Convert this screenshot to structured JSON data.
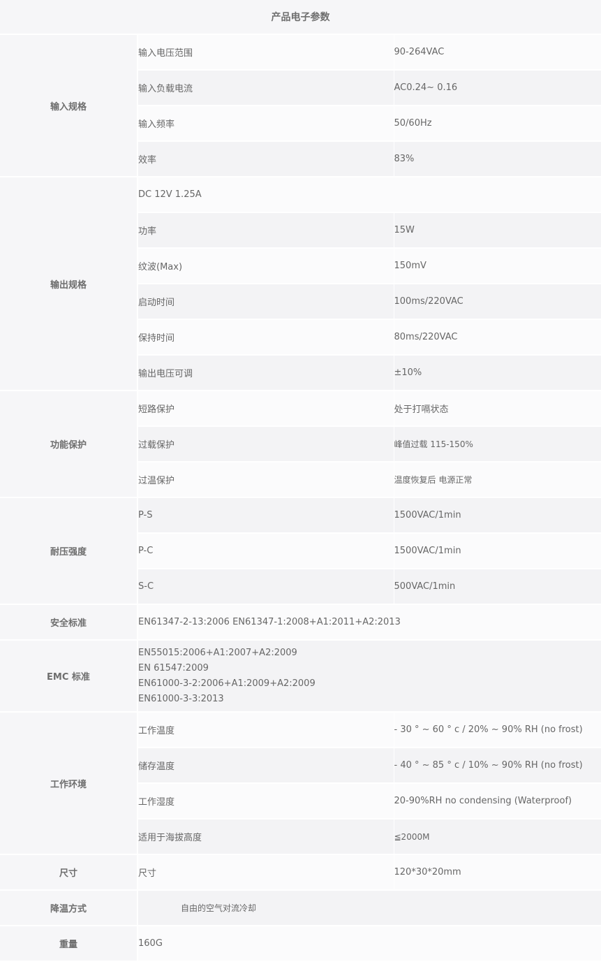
{
  "title": "产品电子参数",
  "input": {
    "label": "输入规格",
    "rows": [
      [
        "输入电压范围",
        "90-264VAC"
      ],
      [
        "输入负载电流",
        "AC0.24~ 0.16"
      ],
      [
        "输入频率",
        "50/60Hz"
      ],
      [
        "效率",
        "83%"
      ]
    ]
  },
  "output": {
    "label": "输出规格",
    "spec": "DC 12V 1.25A",
    "rows": [
      [
        "功率",
        "15W"
      ],
      [
        "纹波(Max)",
        "150mV"
      ],
      [
        "启动时间",
        "100ms/220VAC"
      ],
      [
        "保持时间",
        "80ms/220VAC"
      ],
      [
        "输出电压可调",
        "±10%"
      ]
    ]
  },
  "protection": {
    "label": "功能保护",
    "rows": [
      [
        "短路保护",
        "处于打嗝状态"
      ],
      [
        "过载保护",
        "峰值过载 115-150%"
      ],
      [
        "过温保护",
        "温度恢复后 电源正常"
      ]
    ]
  },
  "withstand": {
    "label": "耐压强度",
    "rows": [
      [
        "P-S",
        "1500VAC/1min"
      ],
      [
        "P-C",
        "1500VAC/1min"
      ],
      [
        "S-C",
        "500VAC/1min"
      ]
    ]
  },
  "safety": {
    "label": "安全标准",
    "value": "EN61347-2-13:2006  EN61347-1:2008+A1:2011+A2:2013"
  },
  "emc": {
    "label": "EMC 标准",
    "lines": [
      "EN55015:2006+A1:2007+A2:2009",
      "EN 61547:2009",
      "EN61000-3-2:2006+A1:2009+A2:2009",
      "EN61000-3-3:2013"
    ]
  },
  "environment": {
    "label": "工作环境",
    "rows": [
      [
        "工作温度",
        "- 30 ° ~ 60 ° c / 20% ~ 90% RH (no frost)"
      ],
      [
        "储存温度",
        "- 40 ° ~ 85 ° c / 10% ~ 90% RH (no frost)"
      ],
      [
        "工作湿度",
        "20-90%RH no condensing (Waterproof)"
      ],
      [
        "适用于海拔高度",
        "≦2000M"
      ]
    ]
  },
  "size": {
    "label": "尺寸",
    "param": "尺寸",
    "value": "120*30*20mm"
  },
  "cooling": {
    "label": "降温方式",
    "value": "自由的空气对流冷却"
  },
  "weight": {
    "label": "重量",
    "value": "160G"
  }
}
